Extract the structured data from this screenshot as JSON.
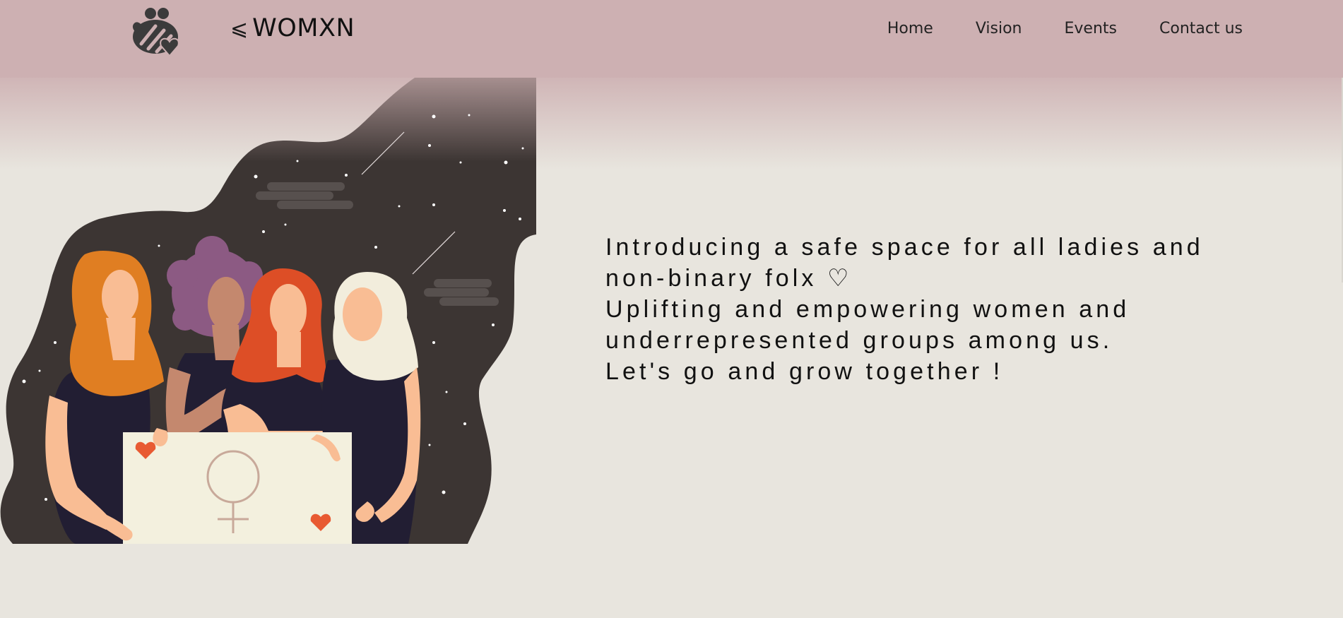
{
  "brand": {
    "glyph": "⩽",
    "name": "WOMXN"
  },
  "nav": {
    "links": [
      "Home",
      "Vision",
      "Events",
      "Contact us"
    ]
  },
  "hero": {
    "lines": [
      "Introducing a safe space for all ladies and",
      "non-binary folx ♡",
      "Uplifting and empowering women and",
      "underrepresented groups among us.",
      "Let's go and grow together !"
    ]
  },
  "colors": {
    "navbar": "#cdb0b2",
    "background": "#e8e5de",
    "night_sky": "#3c3533",
    "sign": "#f3f0de",
    "heart": "#e85a32"
  },
  "icons": {
    "logo": "bee-heart-logo-icon"
  }
}
